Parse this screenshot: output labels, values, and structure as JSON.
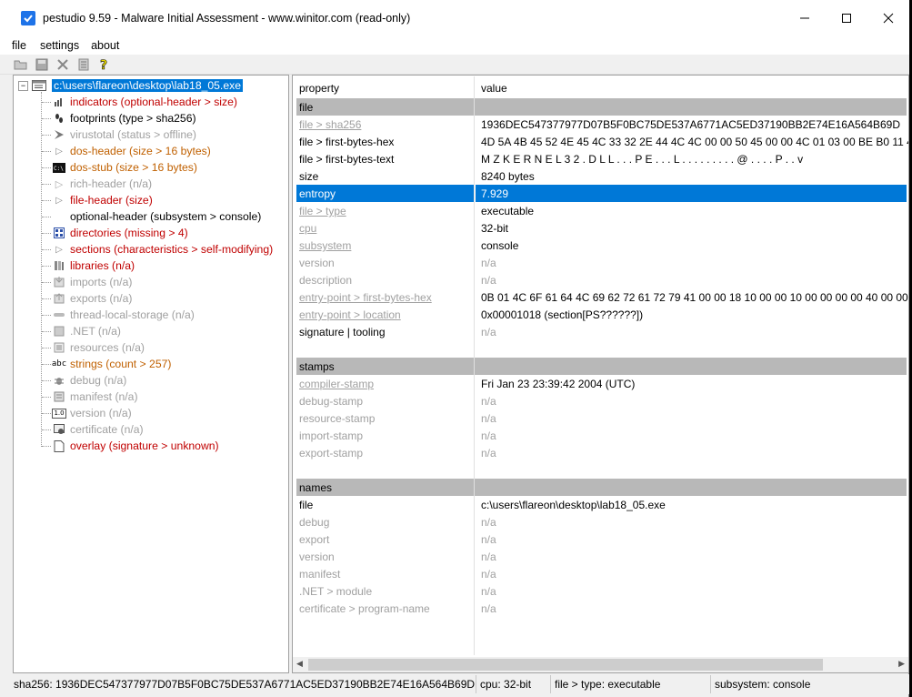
{
  "window": {
    "title": "pestudio 9.59 - Malware Initial Assessment - www.winitor.com (read-only)",
    "minimize": "—",
    "maximize": "☐",
    "close": "✕"
  },
  "menu": [
    "file",
    "settings",
    "about"
  ],
  "toolbar": {
    "icons": [
      "open-icon",
      "save-icon",
      "delete-icon",
      "list-icon",
      "help-icon"
    ]
  },
  "tree": {
    "root": "c:\\users\\flareon\\desktop\\lab18_05.exe",
    "items": [
      {
        "label": "indicators (optional-header > size)",
        "color": "red"
      },
      {
        "label": "footprints (type > sha256)",
        "color": "black"
      },
      {
        "label": "virustotal (status > offline)",
        "color": "gray"
      },
      {
        "label": "dos-header (size > 16 bytes)",
        "color": "orange"
      },
      {
        "label": "dos-stub (size > 16 bytes)",
        "color": "orange"
      },
      {
        "label": "rich-header (n/a)",
        "color": "gray"
      },
      {
        "label": "file-header (size)",
        "color": "red"
      },
      {
        "label": "optional-header (subsystem > console)",
        "color": "black"
      },
      {
        "label": "directories (missing > 4)",
        "color": "red"
      },
      {
        "label": "sections (characteristics > self-modifying)",
        "color": "red"
      },
      {
        "label": "libraries (n/a)",
        "color": "red"
      },
      {
        "label": "imports (n/a)",
        "color": "gray"
      },
      {
        "label": "exports (n/a)",
        "color": "gray"
      },
      {
        "label": "thread-local-storage (n/a)",
        "color": "gray"
      },
      {
        "label": ".NET (n/a)",
        "color": "gray"
      },
      {
        "label": "resources (n/a)",
        "color": "gray"
      },
      {
        "label": "strings (count > 257)",
        "color": "orange"
      },
      {
        "label": "debug (n/a)",
        "color": "gray"
      },
      {
        "label": "manifest (n/a)",
        "color": "gray"
      },
      {
        "label": "version (n/a)",
        "color": "gray"
      },
      {
        "label": "certificate (n/a)",
        "color": "gray"
      },
      {
        "label": "overlay (signature > unknown)",
        "color": "red"
      }
    ]
  },
  "grid": {
    "header": {
      "property": "property",
      "value": "value"
    },
    "rows": [
      {
        "kind": "section",
        "p": "file",
        "v": ""
      },
      {
        "kind": "link-muted",
        "p": "file > sha256",
        "v": "1936DEC547377977D07B5F0BC75DE537A6771AC5ED37190BB2E74E16A564B69D"
      },
      {
        "kind": "normal",
        "p": "file > first-bytes-hex",
        "v": "4D 5A 4B 45 52 4E 45 4C 33 32 2E 44 4C 4C 00 00 50 45 00 00 4C 01 03 00 BE B0 11 40 00 AD"
      },
      {
        "kind": "normal",
        "p": "file > first-bytes-text",
        "v": "M Z K E R N E L 3 2 . D L L . . . P E . . . L . . . . . . . . . @ . . . . P . . v"
      },
      {
        "kind": "normal",
        "p": "size",
        "v": "8240 bytes"
      },
      {
        "kind": "selected",
        "p": "entropy",
        "v": "7.929"
      },
      {
        "kind": "link-muted",
        "p": "file > type",
        "v": "executable"
      },
      {
        "kind": "link-muted",
        "p": "cpu",
        "v": "32-bit"
      },
      {
        "kind": "link-muted",
        "p": "subsystem",
        "v": "console"
      },
      {
        "kind": "muted",
        "p": "version",
        "v": "n/a"
      },
      {
        "kind": "muted",
        "p": "description",
        "v": "n/a"
      },
      {
        "kind": "link-muted",
        "p": "entry-point > first-bytes-hex",
        "v": "0B 01 4C 6F 61 64 4C 69 62 72 61 72 79 41 00 00 18 10 00 00 10 00 00 00 00 40 00 00 00 00 40"
      },
      {
        "kind": "link-muted",
        "p": "entry-point > location",
        "v": "0x00001018 (section[PS??????])"
      },
      {
        "kind": "normal-mutedv",
        "p": "signature | tooling",
        "v": "n/a"
      },
      {
        "kind": "blank",
        "p": "",
        "v": ""
      },
      {
        "kind": "section",
        "p": "stamps",
        "v": ""
      },
      {
        "kind": "link-muted",
        "p": "compiler-stamp",
        "v": "Fri Jan 23 23:39:42 2004 (UTC)"
      },
      {
        "kind": "muted",
        "p": "debug-stamp",
        "v": "n/a"
      },
      {
        "kind": "muted",
        "p": "resource-stamp",
        "v": "n/a"
      },
      {
        "kind": "muted",
        "p": "import-stamp",
        "v": "n/a"
      },
      {
        "kind": "muted",
        "p": "export-stamp",
        "v": "n/a"
      },
      {
        "kind": "blank",
        "p": "",
        "v": ""
      },
      {
        "kind": "section",
        "p": "names",
        "v": ""
      },
      {
        "kind": "normal",
        "p": "file",
        "v": "c:\\users\\flareon\\desktop\\lab18_05.exe"
      },
      {
        "kind": "muted",
        "p": "debug",
        "v": "n/a"
      },
      {
        "kind": "muted",
        "p": "export",
        "v": "n/a"
      },
      {
        "kind": "muted",
        "p": "version",
        "v": "n/a"
      },
      {
        "kind": "muted",
        "p": "manifest",
        "v": "n/a"
      },
      {
        "kind": "muted",
        "p": ".NET > module",
        "v": "n/a"
      },
      {
        "kind": "muted",
        "p": "certificate > program-name",
        "v": "n/a"
      }
    ]
  },
  "status": {
    "sha256": "sha256: 1936DEC547377977D07B5F0BC75DE537A6771AC5ED37190BB2E74E16A564B69D",
    "cpu": "cpu: 32-bit",
    "type": "file > type: executable",
    "subsystem": "subsystem: console"
  },
  "colors": {
    "selection": "#0078d7",
    "red": "#c00000",
    "orange": "#c06000",
    "gray": "#a0a0a0",
    "section": "#b8b8b8"
  }
}
